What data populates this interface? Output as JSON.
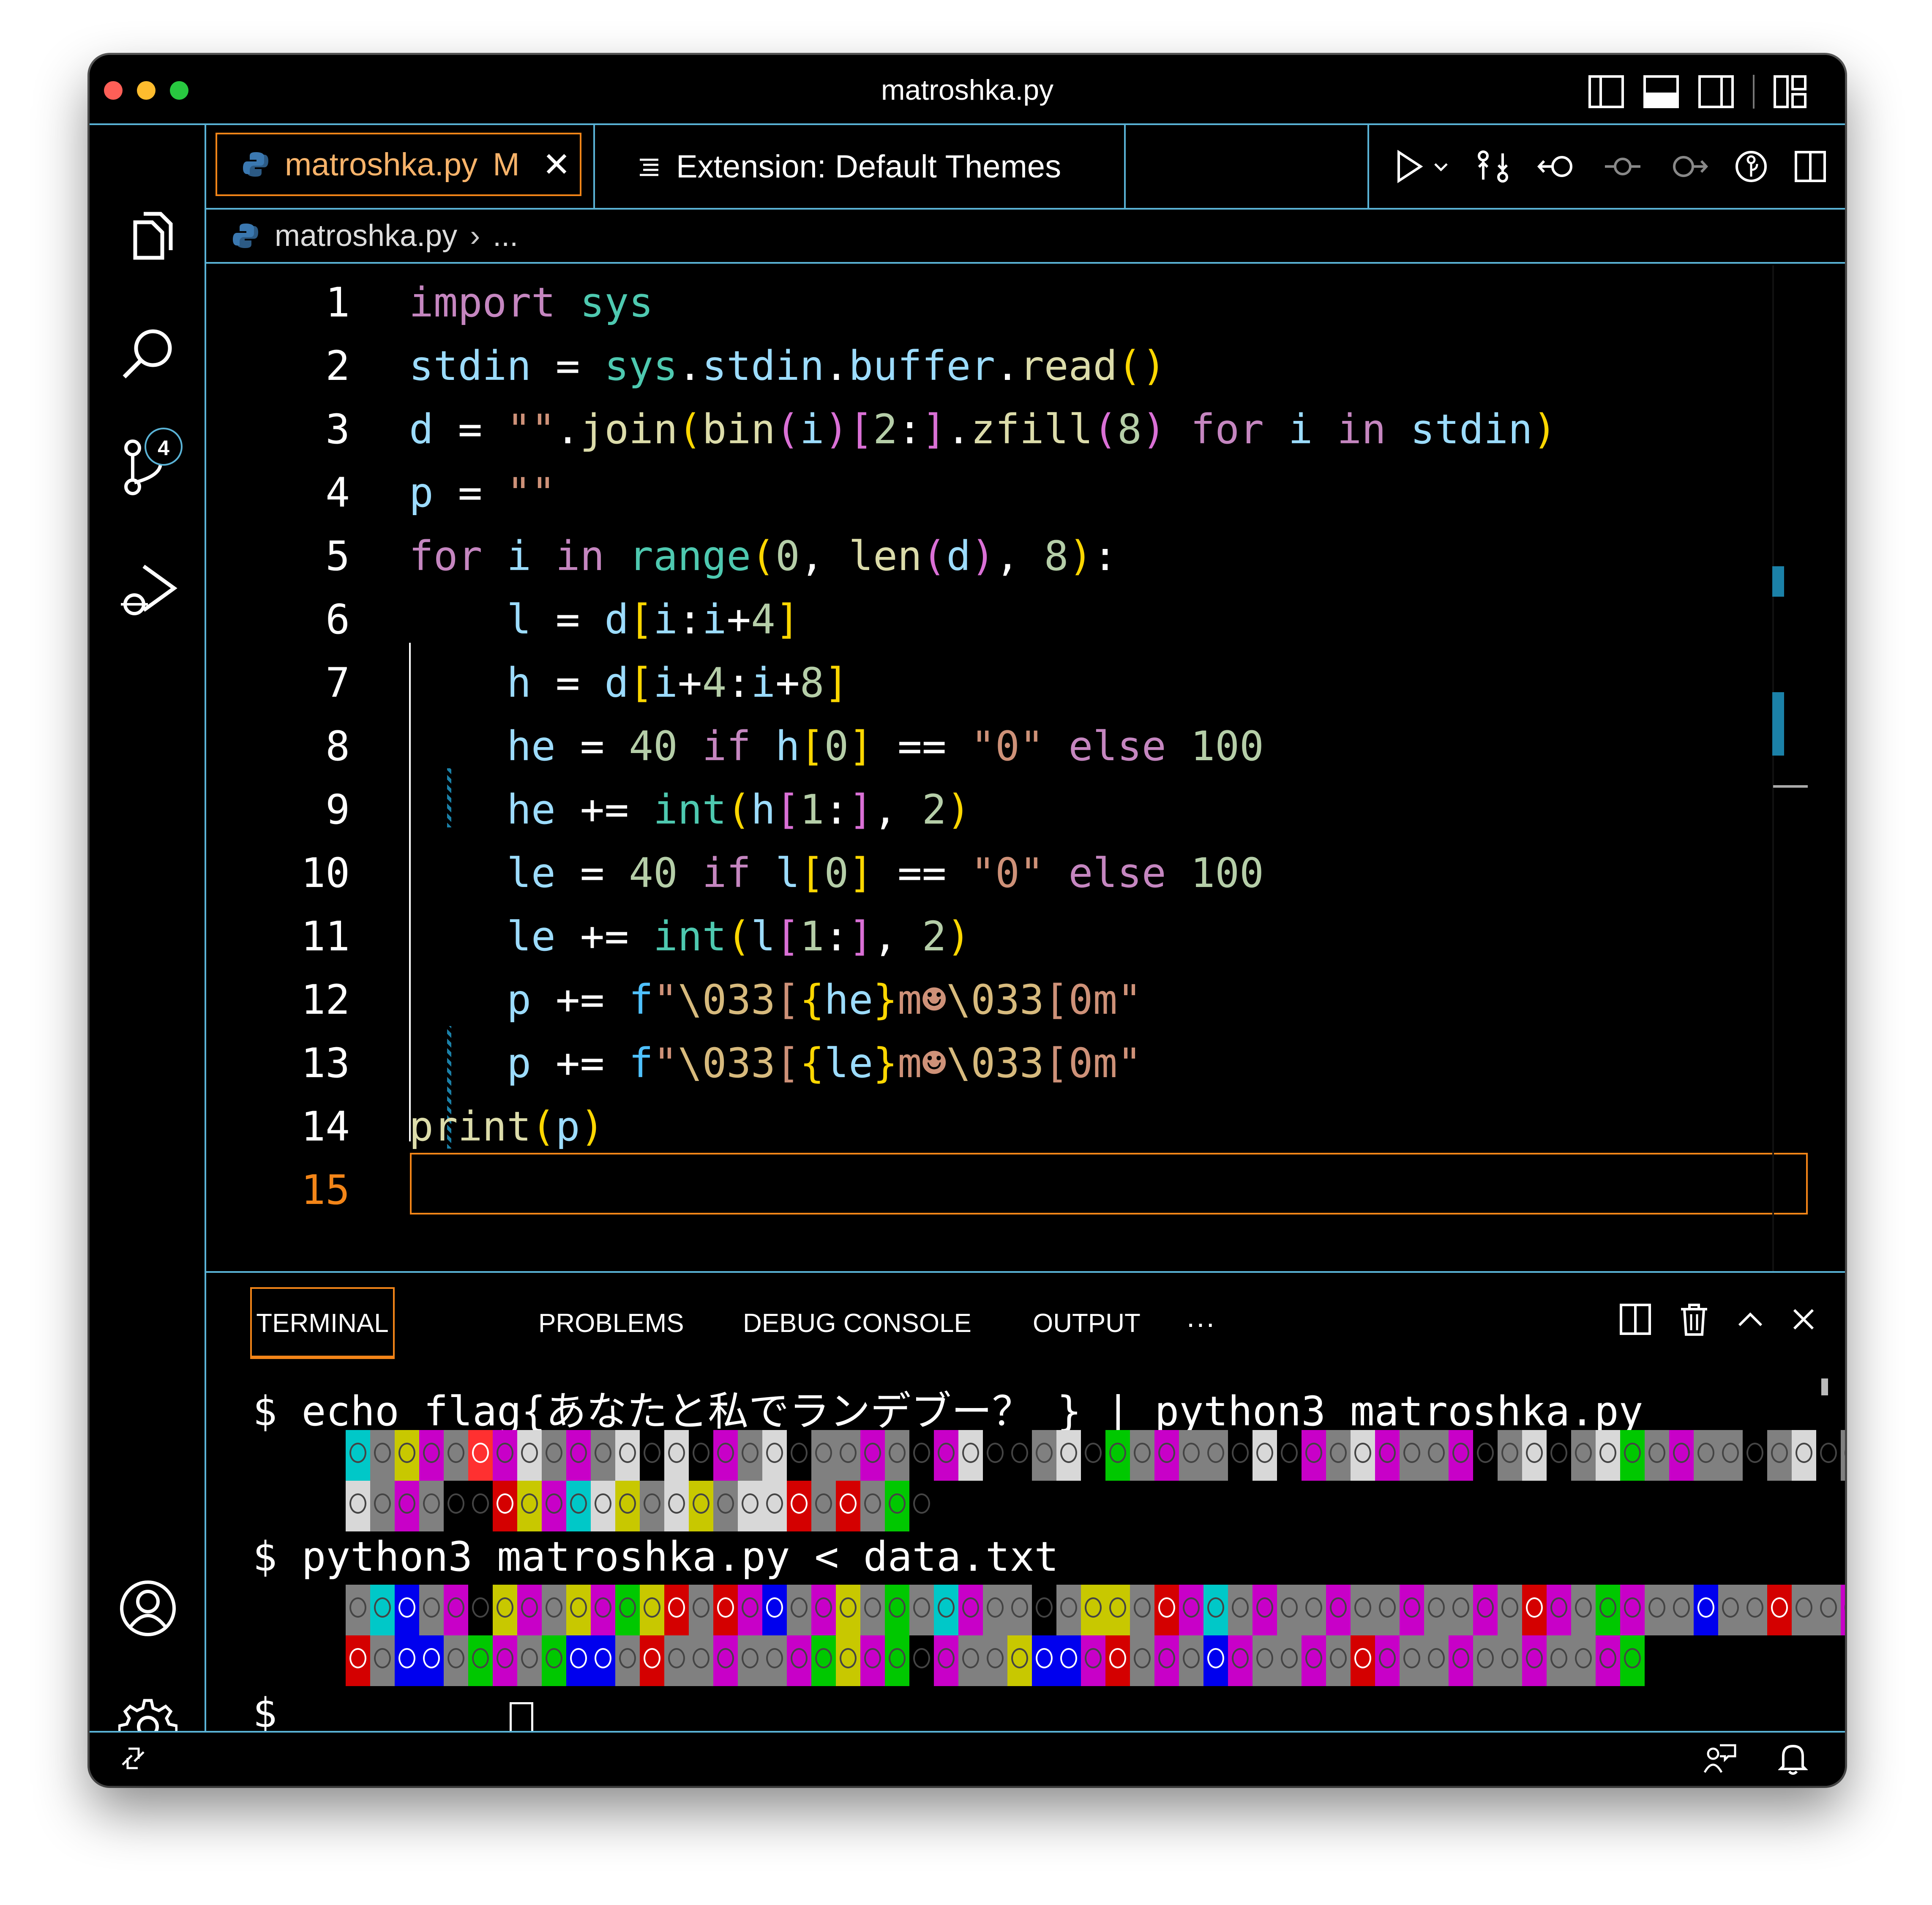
{
  "window": {
    "title": "matroshka.py"
  },
  "activity_bar": {
    "scm_badge": "4"
  },
  "tabs": [
    {
      "label": "matroshka.py",
      "modified": "M"
    },
    {
      "label": "Extension: Default Themes"
    }
  ],
  "breadcrumb": {
    "file": "matroshka.py",
    "more": "..."
  },
  "editor": {
    "line_numbers": [
      "1",
      "2",
      "3",
      "4",
      "5",
      "6",
      "7",
      "8",
      "9",
      "10",
      "11",
      "12",
      "13",
      "14",
      "15"
    ],
    "lines": [
      "import sys",
      "stdin = sys.stdin.buffer.read()",
      "d = \"\".join(bin(i)[2:].zfill(8) for i in stdin)",
      "p = \"\"",
      "for i in range(0, len(d), 8):",
      "    l = d[i:i+4]",
      "    h = d[i+4:i+8]",
      "    he = 40 if h[0] == \"0\" else 100",
      "    he += int(h[1:], 2)",
      "    le = 40 if l[0] == \"0\" else 100",
      "    le += int(l[1:], 2)",
      "    p += f\"\\033[{he}m☻\\033[0m\"",
      "    p += f\"\\033[{le}m☻\\033[0m\"",
      "print(p)",
      ""
    ]
  },
  "panel": {
    "tabs": [
      "TERMINAL",
      "PROBLEMS",
      "DEBUG CONSOLE",
      "OUTPUT",
      "···"
    ],
    "terminal": {
      "cmd1": "$ echo flag{あなたと私でランデブー？ } | python3 matroshka.py",
      "cmd2": "$ python3 matroshka.py < data.txt",
      "prompt": "$",
      "output_rows": [
        "cmymmpmwmmmwkwkmmwkmmmmkmwkkmwkgmmmmkwkmmwmmmmkmwkmwgmmmmkmwkmmmmmmmmmm",
        "wmmmkkrymcwymwymwwrmrmgk",
        "mcbmmkymmymgyrmrmbmmymgmcmmmkmyymrmcmmmmmmmmmmmmrmmgmmmbmmrmmmmmmmmm",
        "rmbbmgmmgbbmrmmmmmmgymgkmmmybbmrmmmbmmmmmrmmmmmmmmmmg"
      ]
    }
  },
  "colors": {
    "accent_border": "#5ab3d6",
    "active_tab_border": "#f38518"
  }
}
